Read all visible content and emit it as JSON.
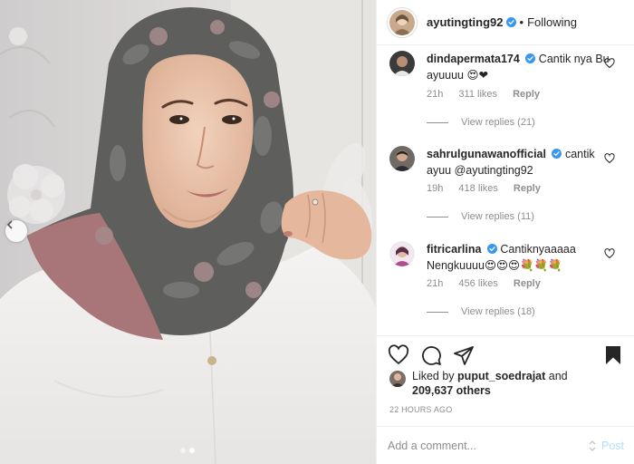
{
  "header": {
    "username": "ayutingting92",
    "separator": "•",
    "follow_status": "Following"
  },
  "comments": [
    {
      "username": "dindapermata174",
      "text": "Cantik nya Bu ayuuuu 😍❤",
      "time": "21h",
      "likes": "311 likes",
      "reply_label": "Reply",
      "view_replies": "View replies (21)"
    },
    {
      "username": "sahrulgunawanofficial",
      "text": "cantik ayuu @ayutingting92",
      "time": "19h",
      "likes": "418 likes",
      "reply_label": "Reply",
      "view_replies": "View replies (11)"
    },
    {
      "username": "fitricarlina",
      "text": "Cantiknyaaaaa Nengkuuuu😍😍😍💐💐💐",
      "time": "21h",
      "likes": "456 likes",
      "reply_label": "Reply",
      "view_replies": "View replies (18)"
    }
  ],
  "likes": {
    "prefix": "Liked by",
    "user": "puput_soedrajat",
    "connector": "and",
    "count": "209,637 others"
  },
  "time_ago": "22 HOURS AGO",
  "add_comment": {
    "placeholder": "Add a comment...",
    "post_label": "Post"
  },
  "carousel": {
    "total_slides": 2,
    "active_slide": 2
  },
  "colors": {
    "verified": "#3897f0",
    "post_disabled": "#b2dffc",
    "meta_text": "#8e8e8e"
  }
}
